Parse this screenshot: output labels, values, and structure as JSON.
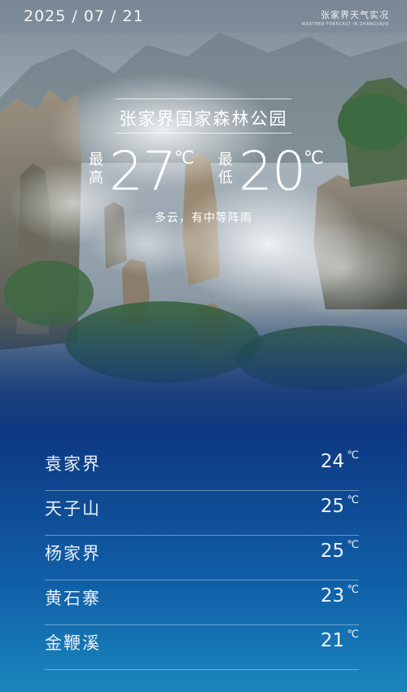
{
  "header": {
    "date": "2025 / 07 / 21",
    "brand_title": "张家界天气实况",
    "brand_subtitle": "WEATHER FORECAST IN ZHANGJIAJIE"
  },
  "weather": {
    "location": "张家界国家森林公园",
    "high_label": "最高",
    "high_value": "27",
    "low_label": "最低",
    "low_value": "20",
    "unit": "℃",
    "condition": "多云，有中等阵雨"
  },
  "spots": [
    {
      "name": "袁家界",
      "temp": "24",
      "unit": "℃"
    },
    {
      "name": "天子山",
      "temp": "25",
      "unit": "℃"
    },
    {
      "name": "杨家界",
      "temp": "25",
      "unit": "℃"
    },
    {
      "name": "黄石寨",
      "temp": "23",
      "unit": "℃"
    },
    {
      "name": "金鞭溪",
      "temp": "21",
      "unit": "℃"
    }
  ],
  "colors": {
    "panel_top": "#0e3680",
    "panel_bottom": "#1a86bd",
    "text": "#ffffff"
  }
}
